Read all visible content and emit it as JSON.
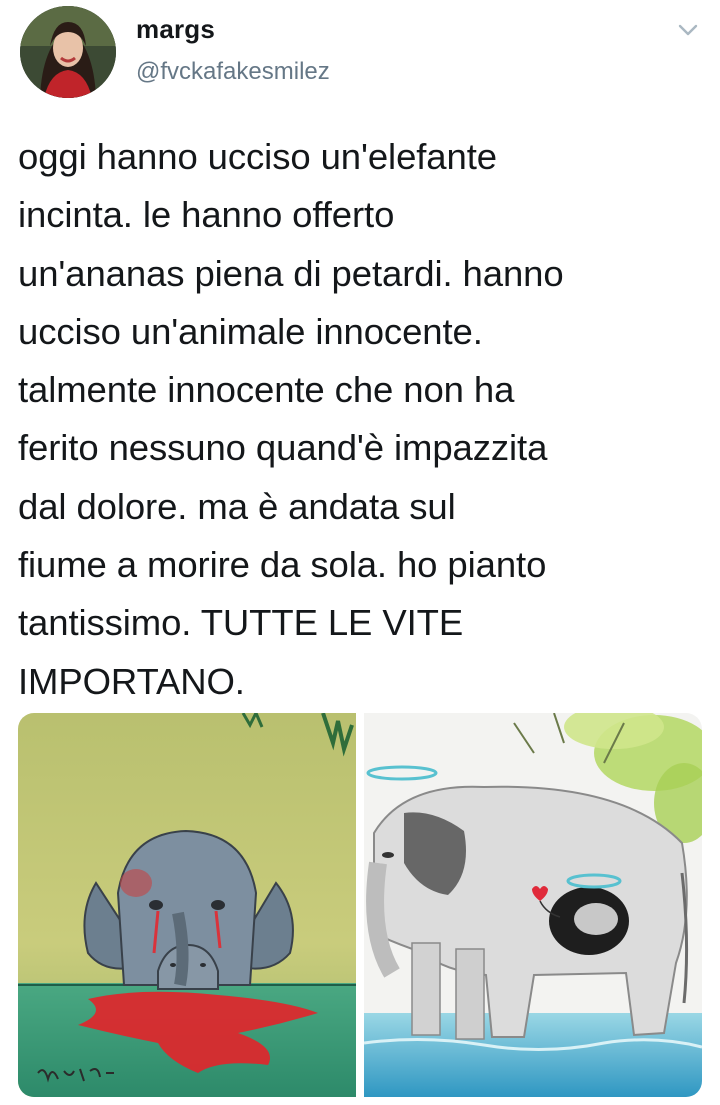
{
  "tweet": {
    "author": {
      "display_name": "margs",
      "handle": "@fvckafakesmilez",
      "avatar_icon": "profile-photo"
    },
    "menu_icon": "chevron-down-icon",
    "text": "oggi hanno ucciso un'elefante\nincinta. le hanno offerto\nun'ananas piena di petardi. hanno\nucciso un'animale innocente.\ntalmente innocente che non ha\nferito nessuno quand'è impazzita\ndal dolore. ma è andata sul\nfiume a morire da sola. ho pianto\ntantissimo. TUTTE LE VITE\nIMPORTANO.",
    "media": [
      {
        "icon": "elephant-crying-illustration",
        "signature": "MAG 2020"
      },
      {
        "icon": "elephant-angel-illustration"
      }
    ]
  },
  "colors": {
    "text": "#14171a",
    "secondary_text": "#657786",
    "chevron": "#aab8c2"
  }
}
